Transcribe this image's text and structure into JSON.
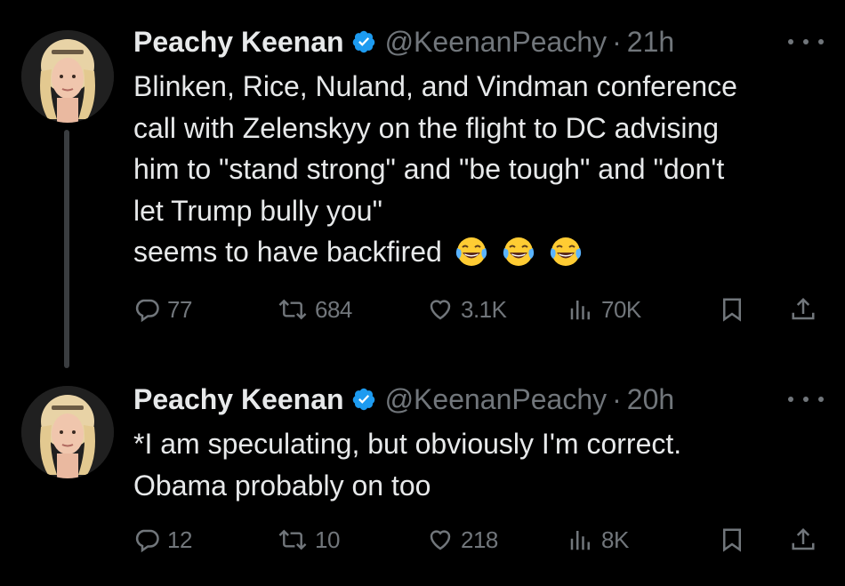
{
  "colors": {
    "background": "#000000",
    "primary_text": "#e7e9ea",
    "secondary_text": "#71767b",
    "verified_badge": "#1d9bf0",
    "thread_line": "#3a3d40"
  },
  "icons": {
    "more": "more-horizontal-icon",
    "verified": "verified-badge-icon",
    "reply": "reply-bubble-icon",
    "retweet": "retweet-arrows-icon",
    "like": "heart-icon",
    "views": "bar-chart-icon",
    "bookmark": "bookmark-icon",
    "share": "share-upload-icon",
    "emoji": "face-with-tears-of-joy"
  },
  "tweets": [
    {
      "author_name": "Peachy Keenan",
      "handle": "@KeenanPeachy",
      "separator": "·",
      "time": "21h",
      "lines": [
        "Blinken, Rice, Nuland, and Vindman conference",
        "call with Zelenskyy on the flight to DC advising",
        "him to \"stand strong\" and \"be tough\" and \"don't",
        "let Trump bully you\"",
        "seems to have backfired"
      ],
      "emoji_count": 3,
      "stats": {
        "replies": "77",
        "retweets": "684",
        "likes": "3.1K",
        "views": "70K"
      }
    },
    {
      "author_name": "Peachy Keenan",
      "handle": "@KeenanPeachy",
      "separator": "·",
      "time": "20h",
      "lines": [
        "*I am speculating, but obviously I'm correct.",
        "Obama probably on too"
      ],
      "emoji_count": 0,
      "stats": {
        "replies": "12",
        "retweets": "10",
        "likes": "218",
        "views": "8K"
      }
    }
  ]
}
